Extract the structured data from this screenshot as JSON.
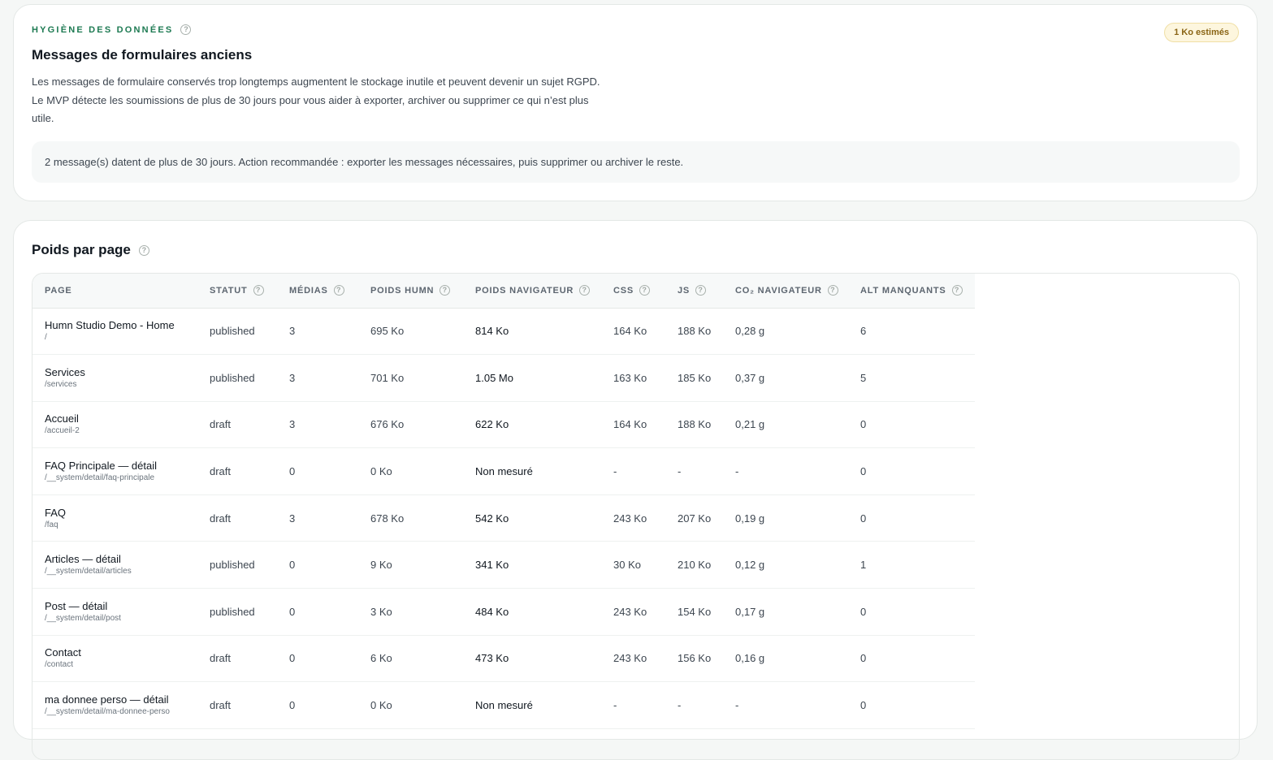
{
  "hygiene": {
    "eyebrow": "HYGIÈNE DES DONNÉES",
    "badge": "1 Ko estimés",
    "title": "Messages de formulaires anciens",
    "desc_line1": "Les messages de formulaire conservés trop longtemps augmentent le stockage inutile et peuvent devenir un sujet RGPD.",
    "desc_line2": "Le MVP détecte les soumissions de plus de 30 jours pour vous aider à exporter, archiver ou supprimer ce qui n’est plus",
    "desc_line3": "utile.",
    "notice": "2 message(s) datent de plus de 30 jours. Action recommandée : exporter les messages nécessaires, puis supprimer ou archiver le reste."
  },
  "weight": {
    "title": "Poids par page",
    "columns": {
      "page": "PAGE",
      "status": "STATUT",
      "medias": "MÉDIAS",
      "humn": "POIDS HUMN",
      "browser": "POIDS NAVIGATEUR",
      "css": "CSS",
      "js": "JS",
      "co2": "CO₂ NAVIGATEUR",
      "alt": "ALT MANQUANTS"
    },
    "rows": [
      {
        "title": "Humn Studio Demo - Home",
        "path": "/",
        "status": "published",
        "medias": "3",
        "humn": "695 Ko",
        "browser": "814 Ko",
        "css": "164 Ko",
        "js": "188 Ko",
        "co2": "0,28 g",
        "alt": "6"
      },
      {
        "title": "Services",
        "path": "/services",
        "status": "published",
        "medias": "3",
        "humn": "701 Ko",
        "browser": "1.05 Mo",
        "css": "163 Ko",
        "js": "185 Ko",
        "co2": "0,37 g",
        "alt": "5"
      },
      {
        "title": "Accueil",
        "path": "/accueil-2",
        "status": "draft",
        "medias": "3",
        "humn": "676 Ko",
        "browser": "622 Ko",
        "css": "164 Ko",
        "js": "188 Ko",
        "co2": "0,21 g",
        "alt": "0"
      },
      {
        "title": "FAQ Principale — détail",
        "path": "/__system/detail/faq-principale",
        "status": "draft",
        "medias": "0",
        "humn": "0 Ko",
        "browser": "Non mesuré",
        "css": "-",
        "js": "-",
        "co2": "-",
        "alt": "0"
      },
      {
        "title": "FAQ",
        "path": "/faq",
        "status": "draft",
        "medias": "3",
        "humn": "678 Ko",
        "browser": "542 Ko",
        "css": "243 Ko",
        "js": "207 Ko",
        "co2": "0,19 g",
        "alt": "0"
      },
      {
        "title": "Articles — détail",
        "path": "/__system/detail/articles",
        "status": "published",
        "medias": "0",
        "humn": "9 Ko",
        "browser": "341 Ko",
        "css": "30 Ko",
        "js": "210 Ko",
        "co2": "0,12 g",
        "alt": "1"
      },
      {
        "title": "Post — détail",
        "path": "/__system/detail/post",
        "status": "published",
        "medias": "0",
        "humn": "3 Ko",
        "browser": "484 Ko",
        "css": "243 Ko",
        "js": "154 Ko",
        "co2": "0,17 g",
        "alt": "0"
      },
      {
        "title": "Contact",
        "path": "/contact",
        "status": "draft",
        "medias": "0",
        "humn": "6 Ko",
        "browser": "473 Ko",
        "css": "243 Ko",
        "js": "156 Ko",
        "co2": "0,16 g",
        "alt": "0"
      },
      {
        "title": "ma donnee perso — détail",
        "path": "/__system/detail/ma-donnee-perso",
        "status": "draft",
        "medias": "0",
        "humn": "0 Ko",
        "browser": "Non mesuré",
        "css": "-",
        "js": "-",
        "co2": "-",
        "alt": "0"
      }
    ]
  }
}
